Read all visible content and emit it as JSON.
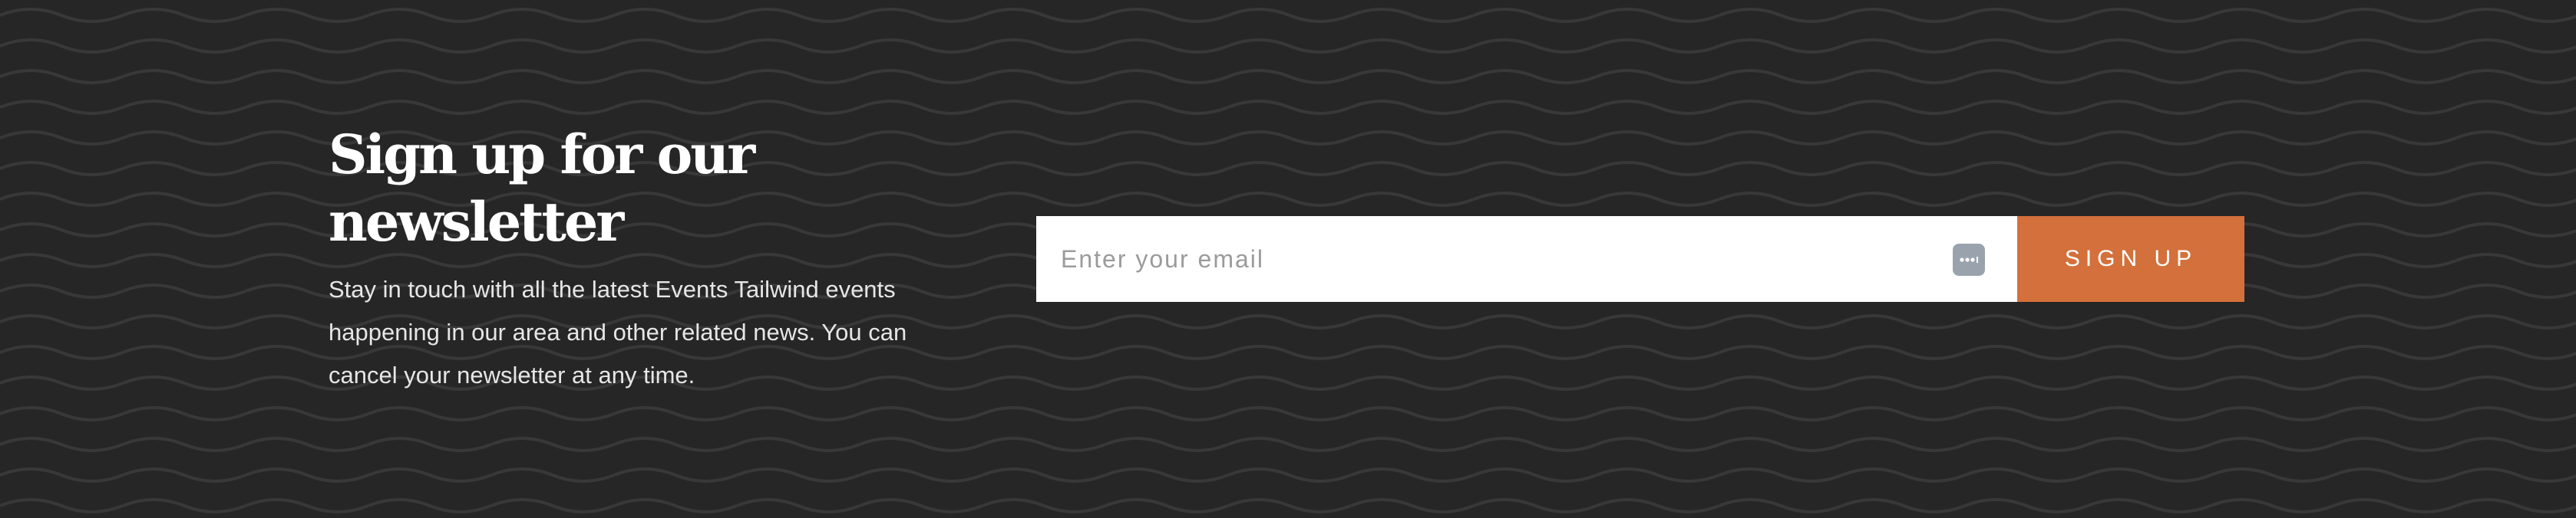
{
  "newsletter": {
    "title": "Sign up for our newsletter",
    "description": "Stay in touch with all the latest Events Tailwind events happening in our area and other related news. You can cancel your newsletter at any time.",
    "email_value": "",
    "email_placeholder": "Enter your email",
    "password_manager_icon": "password-manager-icon",
    "submit_label": "SIGN UP"
  },
  "colors": {
    "background": "#262626",
    "wave_pattern": "#3a3a3a",
    "title": "#ffffff",
    "text": "#e6e6e6",
    "button": "#d4703b",
    "input_background": "#ffffff",
    "placeholder": "#9b9b9b",
    "icon_background": "#9aa3ad"
  }
}
